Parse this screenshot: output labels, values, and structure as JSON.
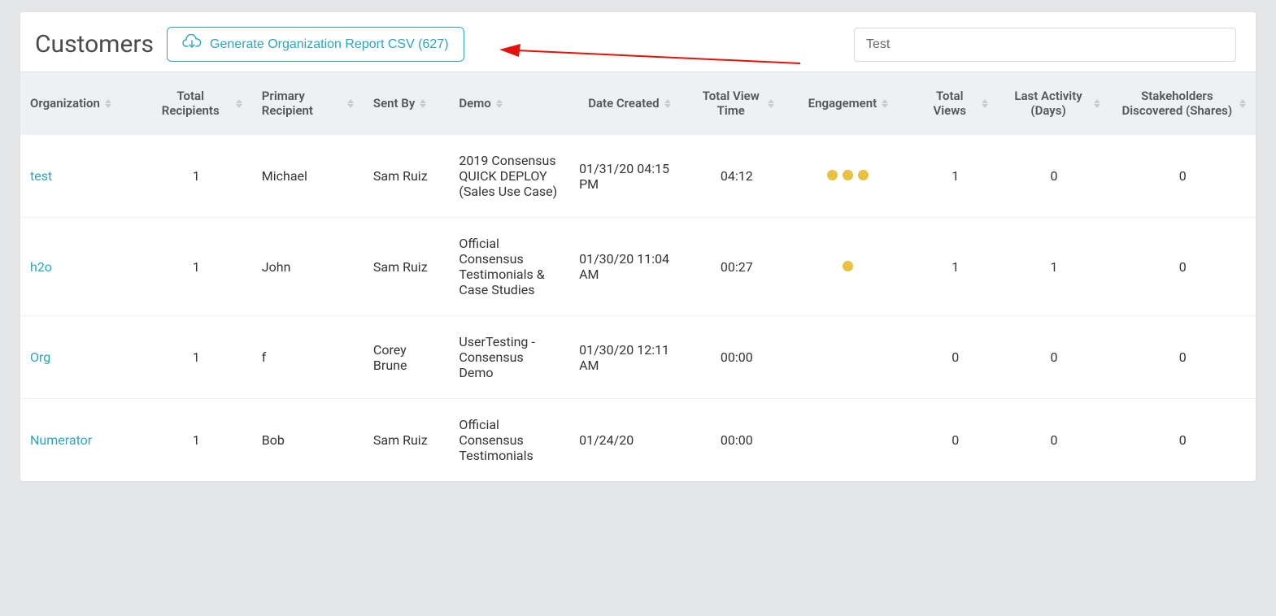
{
  "page": {
    "title": "Customers"
  },
  "csv_button": {
    "label": "Generate Organization Report CSV (627)"
  },
  "search": {
    "value": "Test"
  },
  "columns": [
    {
      "key": "organization",
      "label": "Organization",
      "align": "left"
    },
    {
      "key": "total_recipients",
      "label": "Total Recipients",
      "align": "center"
    },
    {
      "key": "primary_recipient",
      "label": "Primary Recipient",
      "align": "left"
    },
    {
      "key": "sent_by",
      "label": "Sent By",
      "align": "left"
    },
    {
      "key": "demo",
      "label": "Demo",
      "align": "left"
    },
    {
      "key": "date_created",
      "label": "Date Created",
      "align": "center"
    },
    {
      "key": "total_view_time",
      "label": "Total View Time",
      "align": "center"
    },
    {
      "key": "engagement",
      "label": "Engagement",
      "align": "center"
    },
    {
      "key": "total_views",
      "label": "Total Views",
      "align": "center"
    },
    {
      "key": "last_activity",
      "label": "Last Activity (Days)",
      "align": "center"
    },
    {
      "key": "stakeholders",
      "label": "Stakeholders Discovered (Shares)",
      "align": "center"
    }
  ],
  "rows": [
    {
      "organization": "test",
      "total_recipients": "1",
      "primary_recipient": "Michael",
      "sent_by": "Sam Ruiz",
      "demo": "2019 Consensus QUICK DEPLOY (Sales Use Case)",
      "date_created": "01/31/20 04:15 PM",
      "total_view_time": "04:12",
      "engagement_dots": 3,
      "total_views": "1",
      "last_activity": "0",
      "stakeholders": "0"
    },
    {
      "organization": "h2o",
      "total_recipients": "1",
      "primary_recipient": "John",
      "sent_by": "Sam Ruiz",
      "demo": "Official Consensus Testimonials & Case Studies",
      "date_created": "01/30/20 11:04 AM",
      "total_view_time": "00:27",
      "engagement_dots": 1,
      "total_views": "1",
      "last_activity": "1",
      "stakeholders": "0"
    },
    {
      "organization": "Org",
      "total_recipients": "1",
      "primary_recipient": "f",
      "sent_by": "Corey Brune",
      "demo": "UserTesting - Consensus Demo",
      "date_created": "01/30/20 12:11 AM",
      "total_view_time": "00:00",
      "engagement_dots": 0,
      "total_views": "0",
      "last_activity": "0",
      "stakeholders": "0"
    },
    {
      "organization": "Numerator",
      "total_recipients": "1",
      "primary_recipient": "Bob",
      "sent_by": "Sam Ruiz",
      "demo": "Official Consensus Testimonials",
      "date_created": "01/24/20",
      "total_view_time": "00:00",
      "engagement_dots": 0,
      "total_views": "0",
      "last_activity": "0",
      "stakeholders": "0"
    }
  ]
}
